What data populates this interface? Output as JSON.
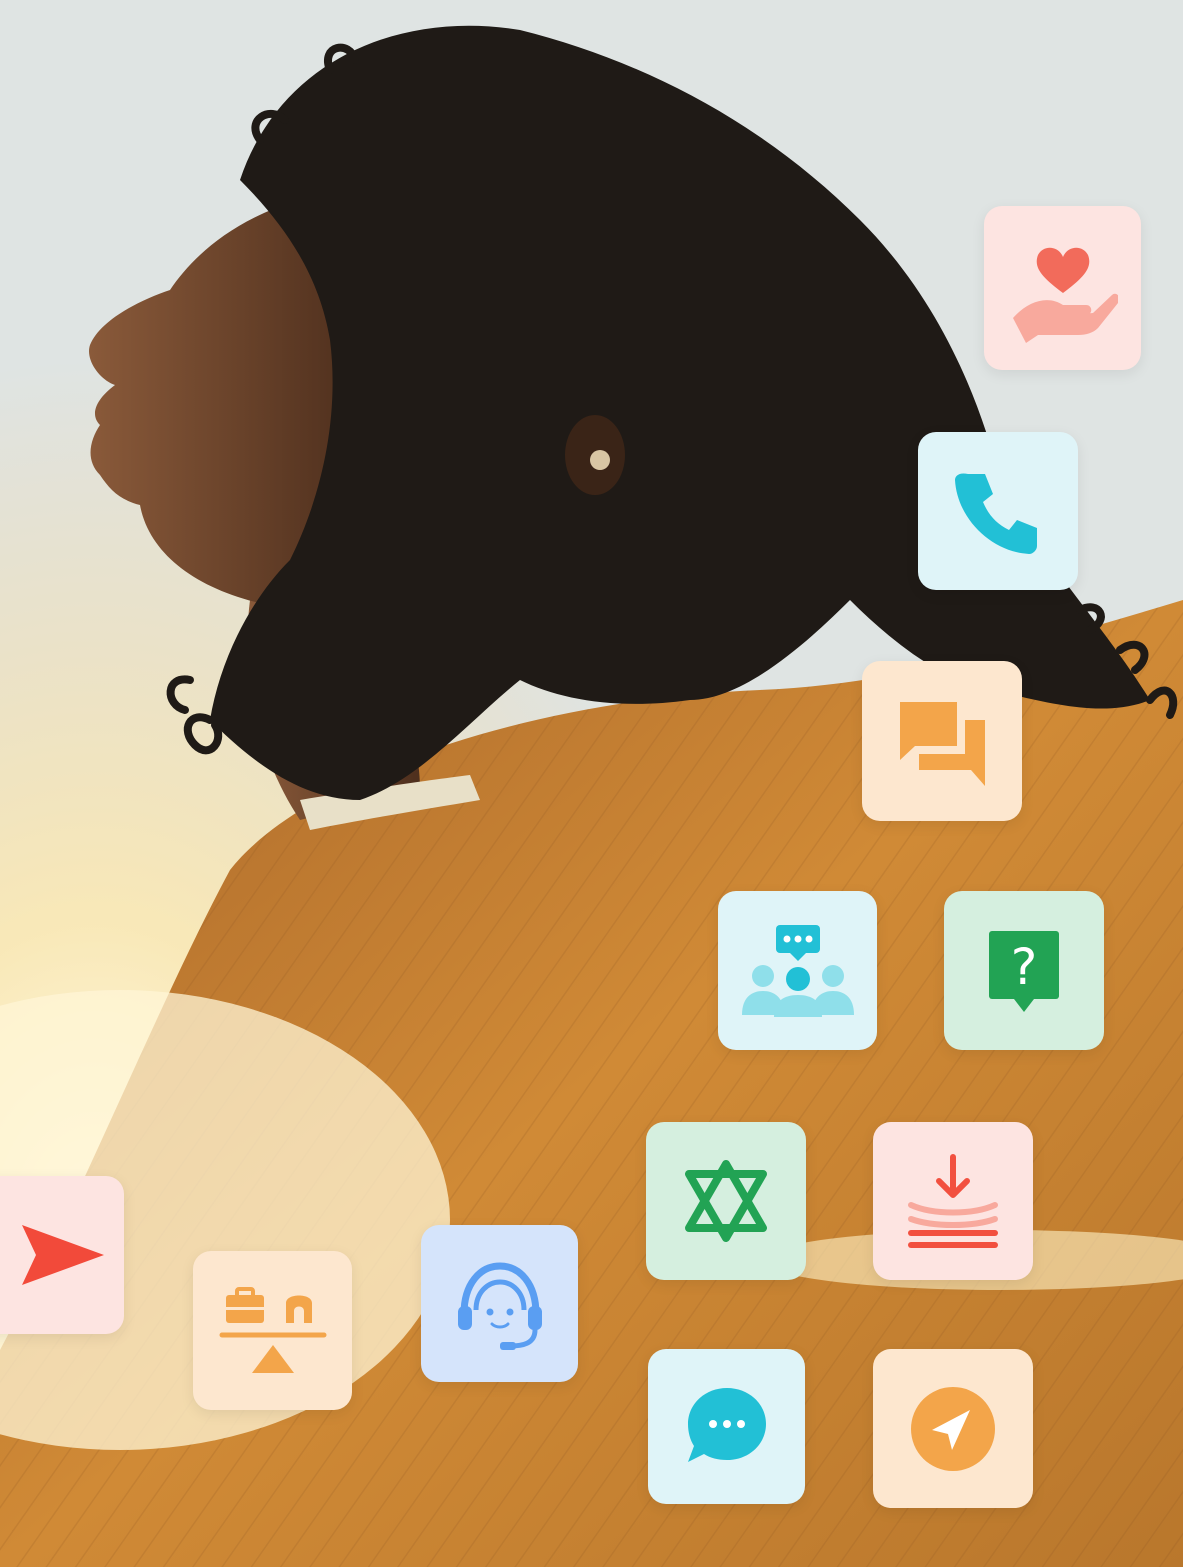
{
  "scene": {
    "subject": "woman-silhouette-sunlight",
    "background_colors": [
      "#d7dee0",
      "#f3e7c8",
      "#f6d79a"
    ],
    "hair_color": "#1f1a16",
    "sweater_color": "#c98a3c",
    "skin_color": "#7a4a2e"
  },
  "tiles": [
    {
      "icon": "heart-hand-icon",
      "bg": "#fde4e1",
      "fg": "#f26b5b"
    },
    {
      "icon": "phone-icon",
      "bg": "#dff4f8",
      "fg": "#22c0d6"
    },
    {
      "icon": "chat-bubbles-icon",
      "bg": "#fde7cf",
      "fg": "#f3a54a"
    },
    {
      "icon": "group-chat-icon",
      "bg": "#dff4f8",
      "fg": "#22c0d6"
    },
    {
      "icon": "question-bubble-icon",
      "bg": "#d5efdf",
      "fg": "#22a354",
      "glyph": "?"
    },
    {
      "icon": "star-of-david-icon",
      "bg": "#d5efdf",
      "fg": "#22a354"
    },
    {
      "icon": "download-layers-icon",
      "bg": "#fde4e1",
      "fg": "#f2503f"
    },
    {
      "icon": "chevron-right-icon",
      "bg": "#fde4e1",
      "fg": "#f24a3a"
    },
    {
      "icon": "work-life-balance-icon",
      "bg": "#fde7cf",
      "fg": "#f3a54a"
    },
    {
      "icon": "headset-agent-icon",
      "bg": "#d5e4fb",
      "fg": "#5a9ef2"
    },
    {
      "icon": "message-dots-icon",
      "bg": "#dff4f8",
      "fg": "#22c0d6"
    },
    {
      "icon": "navigation-arrow-icon",
      "bg": "#fde7cf",
      "fg": "#f3a54a"
    }
  ]
}
